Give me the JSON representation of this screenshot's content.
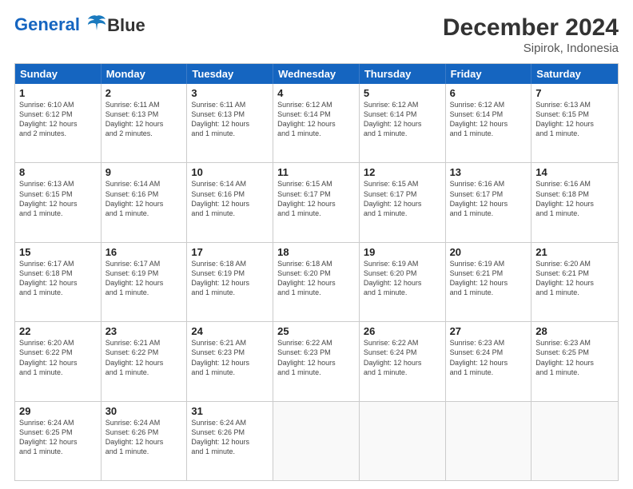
{
  "logo": {
    "line1": "General",
    "line2": "Blue"
  },
  "title": "December 2024",
  "location": "Sipirok, Indonesia",
  "days_of_week": [
    "Sunday",
    "Monday",
    "Tuesday",
    "Wednesday",
    "Thursday",
    "Friday",
    "Saturday"
  ],
  "weeks": [
    [
      {
        "day": 1,
        "sunrise": "6:10 AM",
        "sunset": "6:12 PM",
        "daylight": "12 hours and 2 minutes."
      },
      {
        "day": 2,
        "sunrise": "6:11 AM",
        "sunset": "6:13 PM",
        "daylight": "12 hours and 2 minutes."
      },
      {
        "day": 3,
        "sunrise": "6:11 AM",
        "sunset": "6:13 PM",
        "daylight": "12 hours and 1 minute."
      },
      {
        "day": 4,
        "sunrise": "6:12 AM",
        "sunset": "6:14 PM",
        "daylight": "12 hours and 1 minute."
      },
      {
        "day": 5,
        "sunrise": "6:12 AM",
        "sunset": "6:14 PM",
        "daylight": "12 hours and 1 minute."
      },
      {
        "day": 6,
        "sunrise": "6:12 AM",
        "sunset": "6:14 PM",
        "daylight": "12 hours and 1 minute."
      },
      {
        "day": 7,
        "sunrise": "6:13 AM",
        "sunset": "6:15 PM",
        "daylight": "12 hours and 1 minute."
      }
    ],
    [
      {
        "day": 8,
        "sunrise": "6:13 AM",
        "sunset": "6:15 PM",
        "daylight": "12 hours and 1 minute."
      },
      {
        "day": 9,
        "sunrise": "6:14 AM",
        "sunset": "6:16 PM",
        "daylight": "12 hours and 1 minute."
      },
      {
        "day": 10,
        "sunrise": "6:14 AM",
        "sunset": "6:16 PM",
        "daylight": "12 hours and 1 minute."
      },
      {
        "day": 11,
        "sunrise": "6:15 AM",
        "sunset": "6:17 PM",
        "daylight": "12 hours and 1 minute."
      },
      {
        "day": 12,
        "sunrise": "6:15 AM",
        "sunset": "6:17 PM",
        "daylight": "12 hours and 1 minute."
      },
      {
        "day": 13,
        "sunrise": "6:16 AM",
        "sunset": "6:17 PM",
        "daylight": "12 hours and 1 minute."
      },
      {
        "day": 14,
        "sunrise": "6:16 AM",
        "sunset": "6:18 PM",
        "daylight": "12 hours and 1 minute."
      }
    ],
    [
      {
        "day": 15,
        "sunrise": "6:17 AM",
        "sunset": "6:18 PM",
        "daylight": "12 hours and 1 minute."
      },
      {
        "day": 16,
        "sunrise": "6:17 AM",
        "sunset": "6:19 PM",
        "daylight": "12 hours and 1 minute."
      },
      {
        "day": 17,
        "sunrise": "6:18 AM",
        "sunset": "6:19 PM",
        "daylight": "12 hours and 1 minute."
      },
      {
        "day": 18,
        "sunrise": "6:18 AM",
        "sunset": "6:20 PM",
        "daylight": "12 hours and 1 minute."
      },
      {
        "day": 19,
        "sunrise": "6:19 AM",
        "sunset": "6:20 PM",
        "daylight": "12 hours and 1 minute."
      },
      {
        "day": 20,
        "sunrise": "6:19 AM",
        "sunset": "6:21 PM",
        "daylight": "12 hours and 1 minute."
      },
      {
        "day": 21,
        "sunrise": "6:20 AM",
        "sunset": "6:21 PM",
        "daylight": "12 hours and 1 minute."
      }
    ],
    [
      {
        "day": 22,
        "sunrise": "6:20 AM",
        "sunset": "6:22 PM",
        "daylight": "12 hours and 1 minute."
      },
      {
        "day": 23,
        "sunrise": "6:21 AM",
        "sunset": "6:22 PM",
        "daylight": "12 hours and 1 minute."
      },
      {
        "day": 24,
        "sunrise": "6:21 AM",
        "sunset": "6:23 PM",
        "daylight": "12 hours and 1 minute."
      },
      {
        "day": 25,
        "sunrise": "6:22 AM",
        "sunset": "6:23 PM",
        "daylight": "12 hours and 1 minute."
      },
      {
        "day": 26,
        "sunrise": "6:22 AM",
        "sunset": "6:24 PM",
        "daylight": "12 hours and 1 minute."
      },
      {
        "day": 27,
        "sunrise": "6:23 AM",
        "sunset": "6:24 PM",
        "daylight": "12 hours and 1 minute."
      },
      {
        "day": 28,
        "sunrise": "6:23 AM",
        "sunset": "6:25 PM",
        "daylight": "12 hours and 1 minute."
      }
    ],
    [
      {
        "day": 29,
        "sunrise": "6:24 AM",
        "sunset": "6:25 PM",
        "daylight": "12 hours and 1 minute."
      },
      {
        "day": 30,
        "sunrise": "6:24 AM",
        "sunset": "6:26 PM",
        "daylight": "12 hours and 1 minute."
      },
      {
        "day": 31,
        "sunrise": "6:24 AM",
        "sunset": "6:26 PM",
        "daylight": "12 hours and 1 minute."
      },
      null,
      null,
      null,
      null
    ]
  ]
}
